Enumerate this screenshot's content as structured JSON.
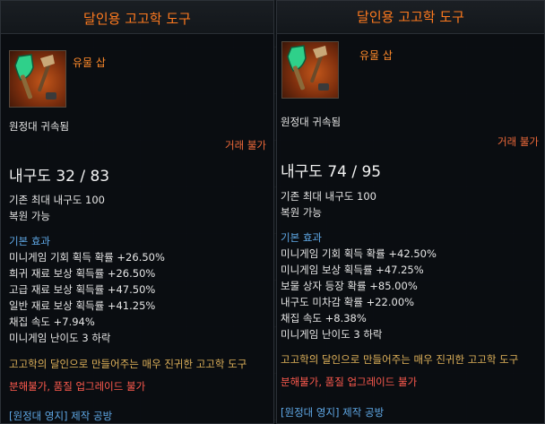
{
  "panels": [
    {
      "item_name": "달인용 고고학 도구",
      "icon": "shovel-brush-icon",
      "grade": "유물 삽",
      "bound": "원정대 귀속됨",
      "trade": "거래 불가",
      "durability_label": "내구도",
      "durability_current": "32",
      "durability_max": "83",
      "durability_text": "내구도 32 / 83",
      "base_max": "기존 최대 내구도 100",
      "restorable": "복원 가능",
      "effects_title": "기본 효과",
      "effects": [
        "미니게임 기회 획득 확률 +26.50%",
        "희귀 재료 보상 획득률 +26.50%",
        "고급 재료 보상 획득률 +47.50%",
        "일반 재료 보상 획득률 +41.25%",
        "채집 속도 +7.94%",
        "미니게임 난이도 3 하락"
      ],
      "description": "고고학의 달인으로 만들어주는 매우 진귀한 고고학 도구",
      "restrictions": "분해불가, 품질 업그레이드 불가",
      "source": "[원정대 영지] 제작 공방"
    },
    {
      "item_name": "달인용 고고학 도구",
      "icon": "shovel-brush-icon",
      "grade": "유물 삽",
      "bound": "원정대 귀속됨",
      "trade": "거래 불가",
      "durability_label": "내구도",
      "durability_current": "74",
      "durability_max": "95",
      "durability_text": "내구도 74 / 95",
      "base_max": "기존 최대 내구도 100",
      "restorable": "복원 가능",
      "effects_title": "기본 효과",
      "effects": [
        "미니게임 기회 획득 확률 +42.50%",
        "미니게임 보상 획득률 +47.25%",
        "보물 상자 등장 확률 +85.00%",
        "내구도 미차감 확률 +22.00%",
        "채집 속도 +8.38%",
        "미니게임 난이도 3 하락"
      ],
      "description": "고고학의 달인으로 만들어주는 매우 진귀한 고고학 도구",
      "restrictions": "분해불가, 품질 업그레이드 불가",
      "source": "[원정대 영지] 제작 공방"
    }
  ],
  "colors": {
    "item_name": "#ff7a1e",
    "grade": "#ff8a2a",
    "trade": "#f06a3a",
    "effects_title": "#5fa8e6",
    "description": "#e0b25a",
    "restrictions": "#ff5a4e",
    "source": "#5fa8e6"
  }
}
